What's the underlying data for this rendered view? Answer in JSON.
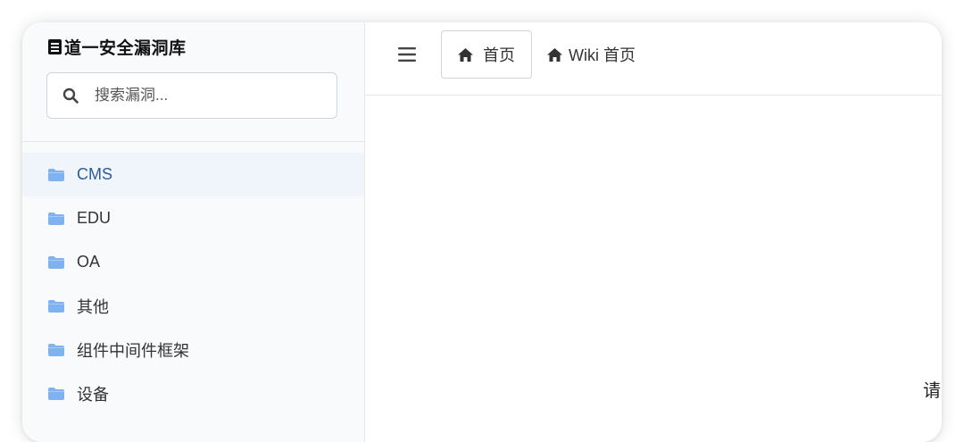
{
  "brand": {
    "title": "道一安全漏洞库",
    "icon": "book-icon"
  },
  "search": {
    "placeholder": "搜索漏洞...",
    "value": "",
    "icon": "search-icon"
  },
  "sidebar": {
    "items": [
      {
        "label": "CMS",
        "icon": "folder-icon",
        "active": true
      },
      {
        "label": "EDU",
        "icon": "folder-icon",
        "active": false
      },
      {
        "label": "OA",
        "icon": "folder-icon",
        "active": false
      },
      {
        "label": "其他",
        "icon": "folder-icon",
        "active": false
      },
      {
        "label": "组件中间件框架",
        "icon": "folder-icon",
        "active": false
      },
      {
        "label": "设备",
        "icon": "folder-icon",
        "active": false
      }
    ]
  },
  "topbar": {
    "menu_icon": "hamburger-menu-icon",
    "home_tab_label": "首页",
    "wiki_link_label": "Wiki 首页"
  },
  "edge_text": "请",
  "colors": {
    "accent": "#2c5aa0",
    "folder": "#7fb2f0",
    "sidebar_bg": "#f8fafb",
    "active_bg": "#f0f5fb",
    "border": "#e3e6ea"
  }
}
